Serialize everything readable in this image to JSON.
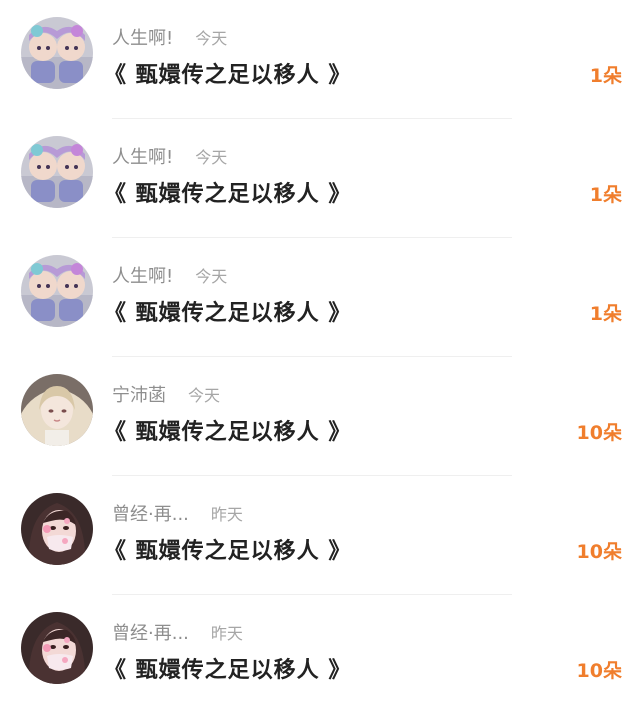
{
  "accent_color": "#f07e2d",
  "items": [
    {
      "name": "人生啊!",
      "time": "今天",
      "title": "《 甄嬛传之足以移人 》",
      "count": "1朵",
      "avatar": "doll-avatar"
    },
    {
      "name": "人生啊!",
      "time": "今天",
      "title": "《 甄嬛传之足以移人 》",
      "count": "1朵",
      "avatar": "doll-avatar"
    },
    {
      "name": "人生啊!",
      "time": "今天",
      "title": "《 甄嬛传之足以移人 》",
      "count": "1朵",
      "avatar": "doll-avatar"
    },
    {
      "name": "宁沛菡",
      "time": "今天",
      "title": "《 甄嬛传之足以移人 》",
      "count": "10朵",
      "avatar": "anime-girl-avatar"
    },
    {
      "name": "曾经·再...",
      "time": "昨天",
      "title": "《 甄嬛传之足以移人 》",
      "count": "10朵",
      "avatar": "masked-girl-avatar"
    },
    {
      "name": "曾经·再...",
      "time": "昨天",
      "title": "《 甄嬛传之足以移人 》",
      "count": "10朵",
      "avatar": "masked-girl-avatar"
    }
  ]
}
